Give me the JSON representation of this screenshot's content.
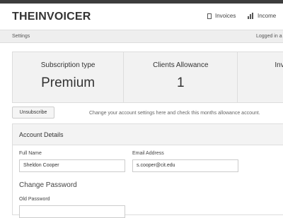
{
  "app": {
    "title": "THEINVOICER"
  },
  "nav": {
    "items": [
      {
        "label": "Invoices",
        "icon": "document-icon"
      },
      {
        "label": "Income",
        "icon": "bar-chart-icon"
      }
    ]
  },
  "subbar": {
    "breadcrumb": "Settings",
    "status": "Logged in a"
  },
  "stats": [
    {
      "label": "Subscription type",
      "value": "Premium"
    },
    {
      "label": "Clients Allowance",
      "value": "1"
    },
    {
      "label": "Inv",
      "value": ""
    }
  ],
  "actions": {
    "unsubscribe_label": "Unsubscribe",
    "help_text": "Change your account settings here and check this months allowance account."
  },
  "account": {
    "title": "Account Details",
    "full_name_label": "Full Name",
    "full_name_value": "Sheldon Cooper",
    "email_label": "Email Address",
    "email_value": "s.cooper@cit.edu",
    "change_password_title": "Change Password",
    "old_password_label": "Old Password"
  },
  "colors": {
    "topbar": "#3d3d3d",
    "subbar": "#eeeeee",
    "stats_bg": "#f2f2f2"
  }
}
